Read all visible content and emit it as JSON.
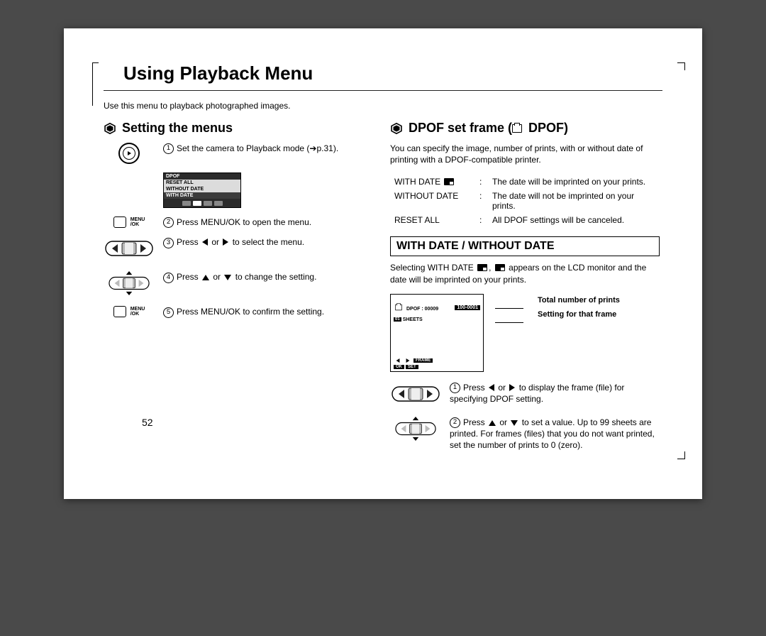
{
  "page": {
    "title": "Using Playback Menu",
    "intro": "Use this menu to playback photographed images.",
    "number": "52"
  },
  "left": {
    "heading": "Setting the menus",
    "step1": "Set the camera to Playback mode (➔p.31).",
    "step2": "Press MENU/OK to open the menu.",
    "step3_pre": "Press ",
    "step3_post": " to select the menu.",
    "step4_pre": "Press ",
    "step4_post": " to change the setting.",
    "step5": "Press MENU/OK to confirm the setting.",
    "or": " or ",
    "menuok": "MENU\n/OK",
    "lcd": {
      "head": "DPOF",
      "item1": "RESET ALL",
      "item2": "WITHOUT DATE",
      "item3": "WITH DATE"
    }
  },
  "right": {
    "heading_pre": "DPOF set frame (",
    "heading_post": " DPOF)",
    "intro": "You can specify the image, number of prints, with or without date of printing with a DPOF-compatible printer.",
    "tbl": {
      "withdate_k": "WITH DATE",
      "withdate_v": "The date will be imprinted on your prints.",
      "withoutdate_k": "WITHOUT DATE",
      "withoutdate_v": "The date will not be imprinted on your prints.",
      "resetall_k": "RESET ALL",
      "resetall_v": "All DPOF settings will be canceled.",
      "colon": ":"
    },
    "boxed": "WITH DATE / WITHOUT DATE",
    "sub_pre": "Selecting WITH DATE ",
    "sub_post": " appears on the LCD monitor and the date will be imprinted on your prints.",
    "comma": ", ",
    "lcd2": {
      "badge": "100-0001",
      "dpof": "DPOF : 00009",
      "sheets_n": "01",
      "sheets": "SHEETS",
      "frame": "FRAME",
      "set": "SET",
      "ok": "OK"
    },
    "caption1": "Total number of prints",
    "caption2": "Setting for that frame",
    "dstep1_pre": "Press ",
    "dstep1_post": " to display the frame (file) for specifying DPOF setting.",
    "dstep2_pre": "Press ",
    "dstep2_mid": " to set a value. Up to 99 sheets are printed. For frames (files) that you do not want printed, set the number of prints to 0 (zero).",
    "or2": " or "
  }
}
